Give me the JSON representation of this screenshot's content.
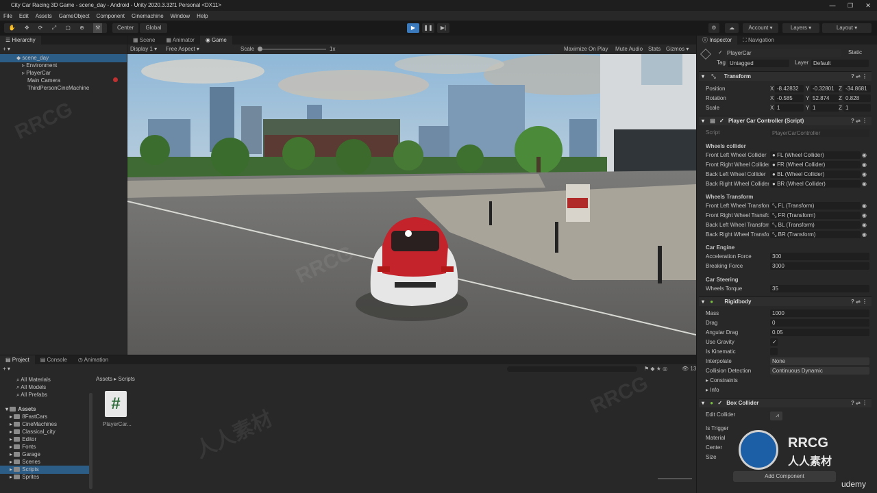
{
  "window": {
    "title": "City Car Racing 3D Game - scene_day - Android - Unity 2020.3.32f1 Personal <DX11>"
  },
  "menu": [
    "File",
    "Edit",
    "Assets",
    "GameObject",
    "Component",
    "Cinemachine",
    "Window",
    "Help"
  ],
  "toolbar": {
    "center": "Center",
    "global": "Global",
    "account": "Account",
    "layers": "Layers",
    "layout": "Layout"
  },
  "hierarchy": {
    "tab": "Hierarchy",
    "scene": "scene_day",
    "items": [
      "Environment",
      "PlayerCar",
      "Main Camera",
      "ThirdPersonCineMachine"
    ]
  },
  "game": {
    "tabs": [
      "Scene",
      "Animator",
      "Game"
    ],
    "display": "Display 1",
    "aspect": "Free Aspect",
    "scale_label": "Scale",
    "scale_value": "1x",
    "options": [
      "Maximize On Play",
      "Mute Audio",
      "Stats",
      "Gizmos"
    ]
  },
  "inspector": {
    "tabs": [
      "Inspector",
      "Navigation"
    ],
    "object_name": "PlayerCar",
    "static_label": "Static",
    "tag_label": "Tag",
    "tag_value": "Untagged",
    "layer_label": "Layer",
    "layer_value": "Default",
    "transform": {
      "title": "Transform",
      "position_label": "Position",
      "position": [
        "-8.42832",
        "-0.32801",
        "-34.8681"
      ],
      "rotation_label": "Rotation",
      "rotation": [
        "-0.585",
        "52.874",
        "0.828"
      ],
      "scale_label": "Scale",
      "scale": [
        "1",
        "1",
        "1"
      ]
    },
    "controller": {
      "title": "Player Car Controller (Script)",
      "script_label": "Script",
      "script_value": "PlayerCarController",
      "wheels_collider_header": "Wheels collider",
      "colliders": [
        {
          "label": "Front Left Wheel Collider",
          "value": "FL (Wheel Collider)"
        },
        {
          "label": "Front Right Wheel Collider",
          "value": "FR (Wheel Collider)"
        },
        {
          "label": "Back Left Wheel Collider",
          "value": "BL (Wheel Collider)"
        },
        {
          "label": "Back Right Wheel Collider",
          "value": "BR (Wheel Collider)"
        }
      ],
      "wheels_transform_header": "Wheels Transform",
      "transforms": [
        {
          "label": "Front Left Wheel Transform",
          "value": "FL (Transform)"
        },
        {
          "label": "Front Right Wheel Transform",
          "value": "FR (Transform)"
        },
        {
          "label": "Back Left Wheel Transform",
          "value": "BL (Transform)"
        },
        {
          "label": "Back Right Wheel Transform",
          "value": "BR (Transform)"
        }
      ],
      "engine_header": "Car Engine",
      "acceleration_label": "Acceleration Force",
      "acceleration": "300",
      "breaking_label": "Breaking Force",
      "breaking": "3000",
      "steering_header": "Car Steering",
      "torque_label": "Wheels Torque",
      "torque": "35"
    },
    "rigidbody": {
      "title": "Rigidbody",
      "mass_label": "Mass",
      "mass": "1000",
      "drag_label": "Drag",
      "drag": "0",
      "angular_label": "Angular Drag",
      "angular": "0.05",
      "gravity_label": "Use Gravity",
      "gravity": "✓",
      "kinematic_label": "Is Kinematic",
      "interpolate_label": "Interpolate",
      "interpolate": "None",
      "collision_label": "Collision Detection",
      "collision": "Continuous Dynamic",
      "constraints_label": "Constraints",
      "info_label": "Info"
    },
    "boxcollider": {
      "title": "Box Collider",
      "edit_label": "Edit Collider",
      "trigger_label": "Is Trigger",
      "material_label": "Material",
      "center_label": "Center",
      "size_label": "Size"
    },
    "add_component": "Add Component"
  },
  "project": {
    "tabs": [
      "Project",
      "Console",
      "Animation"
    ],
    "favorites": [
      "All Materials",
      "All Models",
      "All Prefabs"
    ],
    "assets_root": "Assets",
    "folders": [
      "8FastCars",
      "CineMachines",
      "Classical_city",
      "Editor",
      "Fonts",
      "Garage",
      "Scenes",
      "Scripts",
      "Sprites"
    ],
    "breadcrumb": [
      "Assets",
      "Scripts"
    ],
    "file_name": "PlayerCar...",
    "count": "13"
  },
  "watermarks": {
    "logo": "RRCG",
    "sub": "人人素材",
    "udemy": "udemy"
  },
  "colors": {
    "selection": "#2c5d87",
    "accent": "#3a79bb"
  }
}
